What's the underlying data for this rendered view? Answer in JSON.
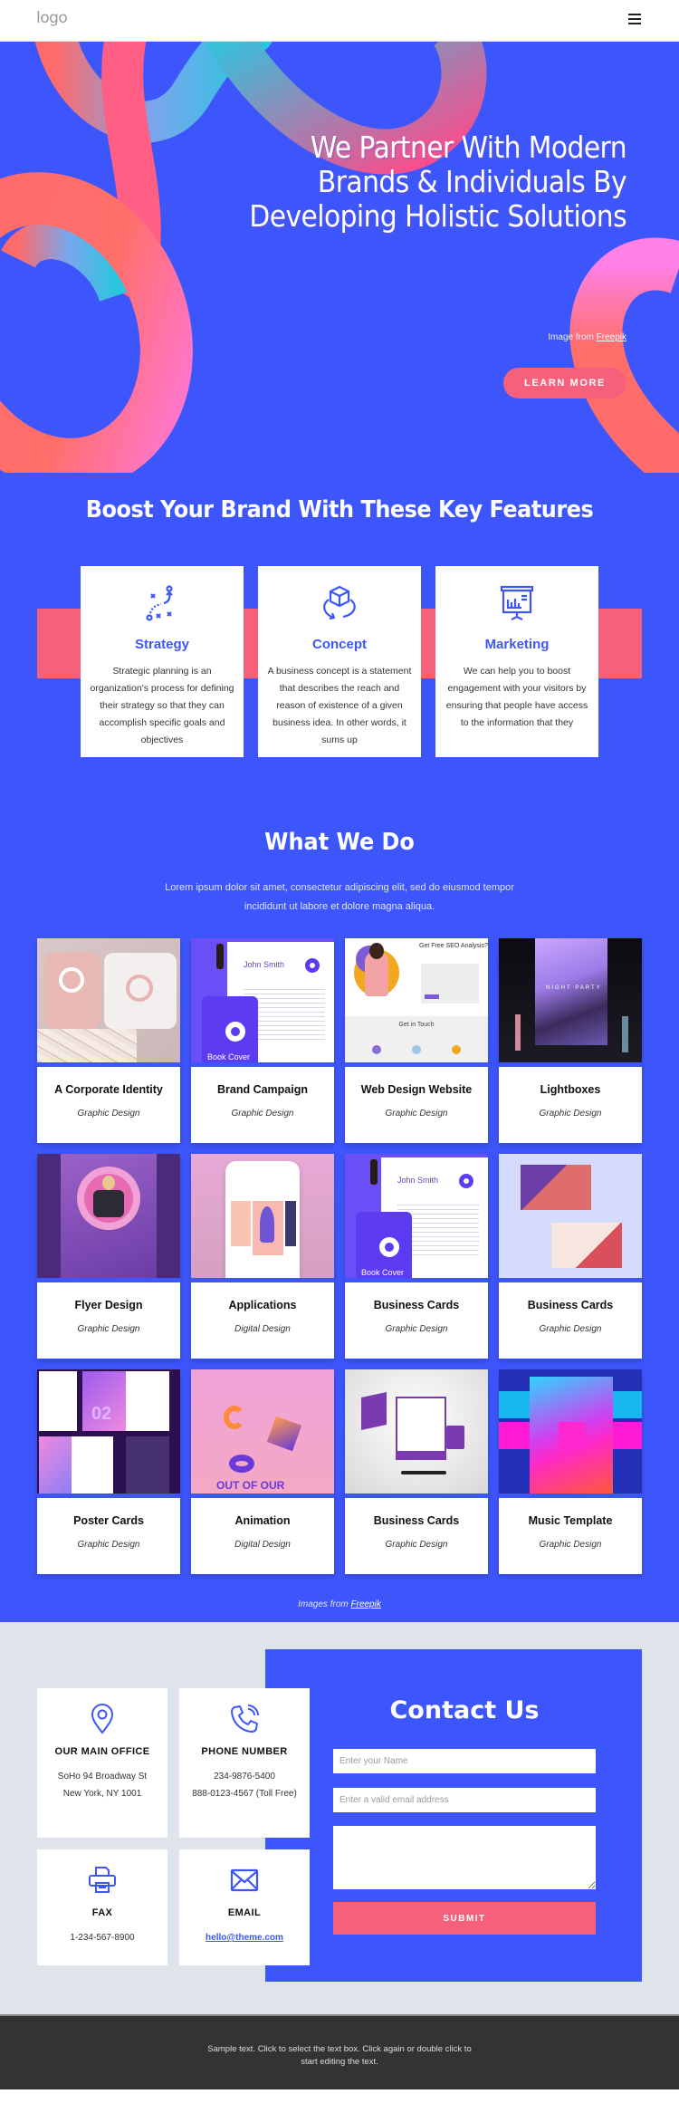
{
  "header": {
    "logo": "logo",
    "menu_icon": "hamburger-menu-icon"
  },
  "hero": {
    "title": "We Partner With Modern Brands & Individuals By Developing Holistic Solutions",
    "credit_prefix": "Image from ",
    "credit_link": "Freepik",
    "cta_label": "LEARN MORE"
  },
  "features": {
    "title": "Boost Your Brand With These Key Features",
    "items": [
      {
        "icon": "strategy-icon",
        "title": "Strategy",
        "text": "Strategic planning is an organization's process for defining their strategy so that they can accomplish specific goals and objectives"
      },
      {
        "icon": "cube-concept-icon",
        "title": "Concept",
        "text": "A business concept is a statement that describes the reach and reason of existence of a given business idea. In other words, it sums up"
      },
      {
        "icon": "presentation-board-icon",
        "title": "Marketing",
        "text": "We can help you to boost engagement with your visitors by ensuring that people have access to the information that they"
      }
    ]
  },
  "work": {
    "title": "What We Do",
    "subtitle": "Lorem ipsum dolor sit amet, consectetur adipiscing elit, sed do eiusmod tempor incididunt ut labore et dolore magna aliqua.",
    "items": [
      {
        "title": "A Corporate Identity",
        "category": "Graphic Design"
      },
      {
        "title": "Brand Campaign",
        "category": "Graphic Design"
      },
      {
        "title": "Web Design Website",
        "category": "Graphic Design"
      },
      {
        "title": "Lightboxes",
        "category": "Graphic Design"
      },
      {
        "title": "Flyer Design",
        "category": "Graphic Design"
      },
      {
        "title": "Applications",
        "category": "Digital Design"
      },
      {
        "title": "Business Cards",
        "category": "Graphic Design"
      },
      {
        "title": "Business Cards",
        "category": "Graphic Design"
      },
      {
        "title": "Poster Cards",
        "category": "Graphic Design"
      },
      {
        "title": "Animation",
        "category": "Digital Design"
      },
      {
        "title": "Business Cards",
        "category": "Graphic Design"
      },
      {
        "title": "Music Template",
        "category": "Graphic Design"
      }
    ],
    "thumb_text": {
      "book_cover": "Book Cover",
      "john_smith": "John Smith",
      "seo": "Get Free SEO Analysis?",
      "get_in_touch": "Get in Touch",
      "night_party": "NIGHT PARTY",
      "poster_02": "02",
      "out_of_our": "OUT OF OUR"
    },
    "credit_prefix": "Images from ",
    "credit_link": "Freepik"
  },
  "contact": {
    "cards": [
      {
        "icon": "location-pin-icon",
        "title": "OUR MAIN OFFICE",
        "lines": [
          "SoHo 94 Broadway St",
          "New York, NY 1001"
        ]
      },
      {
        "icon": "phone-icon",
        "title": "PHONE NUMBER",
        "lines": [
          "234-9876-5400",
          "888-0123-4567 (Toll Free)"
        ]
      },
      {
        "icon": "printer-fax-icon",
        "title": "FAX",
        "lines": [
          "1-234-567-8900"
        ]
      },
      {
        "icon": "envelope-icon",
        "title": "EMAIL",
        "lines": [
          "hello@theme.com"
        ]
      }
    ],
    "title": "Contact Us",
    "name_placeholder": "Enter your Name",
    "email_placeholder": "Enter a valid email address",
    "message_placeholder": "",
    "submit_label": "SUBMIT"
  },
  "footer": {
    "text": "Sample text. Click to select the text box. Click again or double click to start editing the text."
  },
  "colors": {
    "primary_blue": "#3d56fc",
    "accent_pink": "#f6607a",
    "contact_bg": "#dfe3ea",
    "footer_bg": "#333333"
  }
}
